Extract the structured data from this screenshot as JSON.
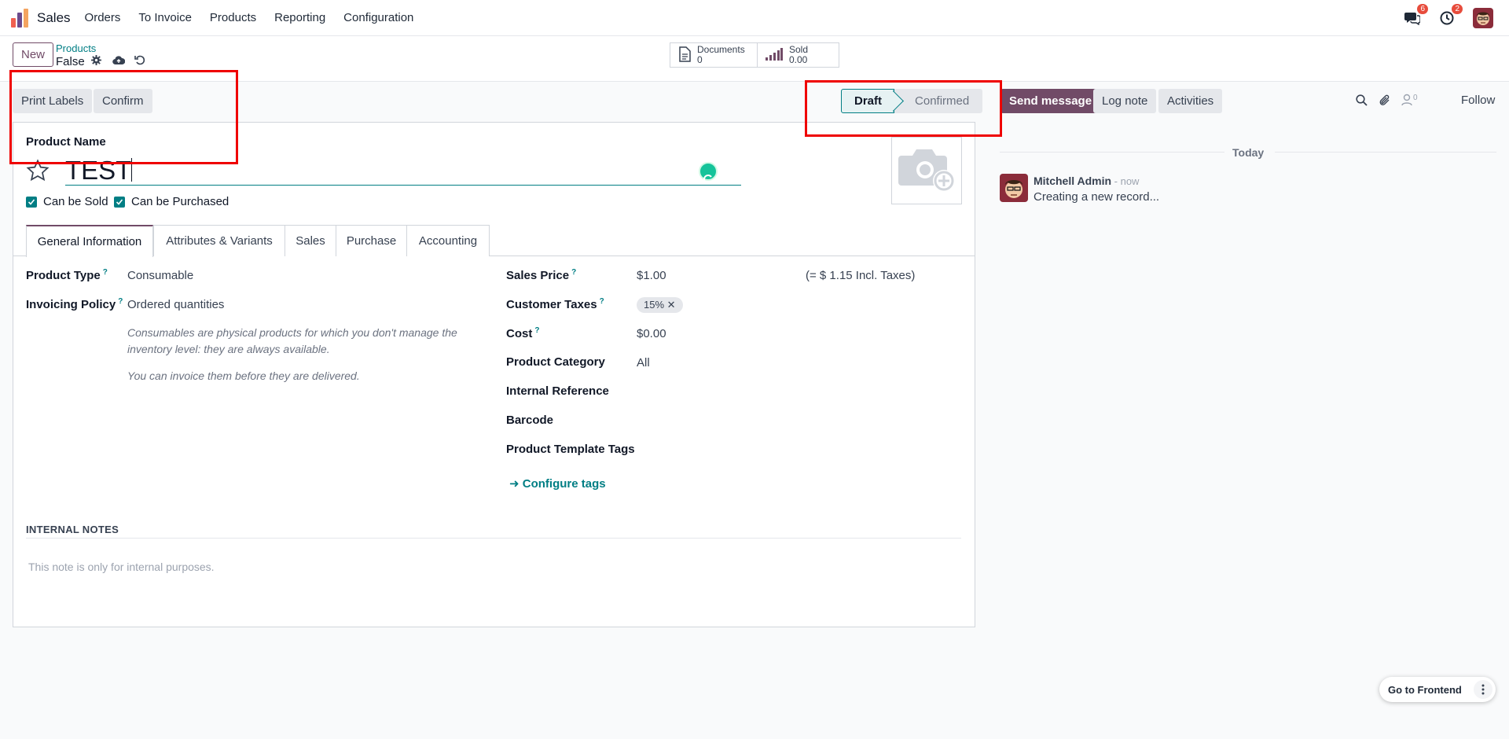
{
  "navbar": {
    "app_name": "Sales",
    "menu": [
      "Orders",
      "To Invoice",
      "Products",
      "Reporting",
      "Configuration"
    ],
    "messages_count": "6",
    "activities_count": "2"
  },
  "control": {
    "new_label": "New",
    "breadcrumb_parent": "Products",
    "breadcrumb_current": "False",
    "smart_buttons": [
      {
        "label": "Documents",
        "value": "0"
      },
      {
        "label": "Sold",
        "value": "0.00"
      }
    ]
  },
  "header": {
    "buttons": [
      "Print Labels",
      "Confirm"
    ],
    "statusbar": [
      "Draft",
      "Confirmed"
    ]
  },
  "form": {
    "name_label": "Product Name",
    "name_value": "TEST",
    "can_be_sold_label": "Can be Sold",
    "can_be_purchased_label": "Can be Purchased",
    "tabs": [
      "General Information",
      "Attributes & Variants",
      "Sales",
      "Purchase",
      "Accounting"
    ],
    "left_fields": {
      "product_type_label": "Product Type",
      "product_type_value": "Consumable",
      "invoicing_policy_label": "Invoicing Policy",
      "invoicing_policy_value": "Ordered quantities",
      "hint1": "Consumables are physical products for which you don't manage the inventory level: they are always available.",
      "hint2": "You can invoice them before they are delivered."
    },
    "right_fields": {
      "sales_price_label": "Sales Price",
      "sales_price_value": "$1.00",
      "incl_taxes": "(= $ 1.15 Incl. Taxes)",
      "customer_taxes_label": "Customer Taxes",
      "customer_taxes_tag": "15%",
      "cost_label": "Cost",
      "cost_value": "$0.00",
      "product_category_label": "Product Category",
      "product_category_value": "All",
      "internal_reference_label": "Internal Reference",
      "barcode_label": "Barcode",
      "template_tags_label": "Product Template Tags",
      "configure_tags": "Configure tags"
    },
    "notes_title": "INTERNAL NOTES",
    "notes_placeholder": "This note is only for internal purposes."
  },
  "chatter": {
    "send_message": "Send message",
    "log_note": "Log note",
    "activities": "Activities",
    "followers_count": "0",
    "follow": "Follow",
    "date_separator": "Today",
    "message": {
      "author": "Mitchell Admin",
      "time": " - now",
      "body": "Creating a new record..."
    }
  },
  "footer": {
    "go_frontend": "Go to Frontend"
  },
  "colors": {
    "brand": "#714b67",
    "accent": "#017e84",
    "highlight_box": "#ef0000"
  }
}
